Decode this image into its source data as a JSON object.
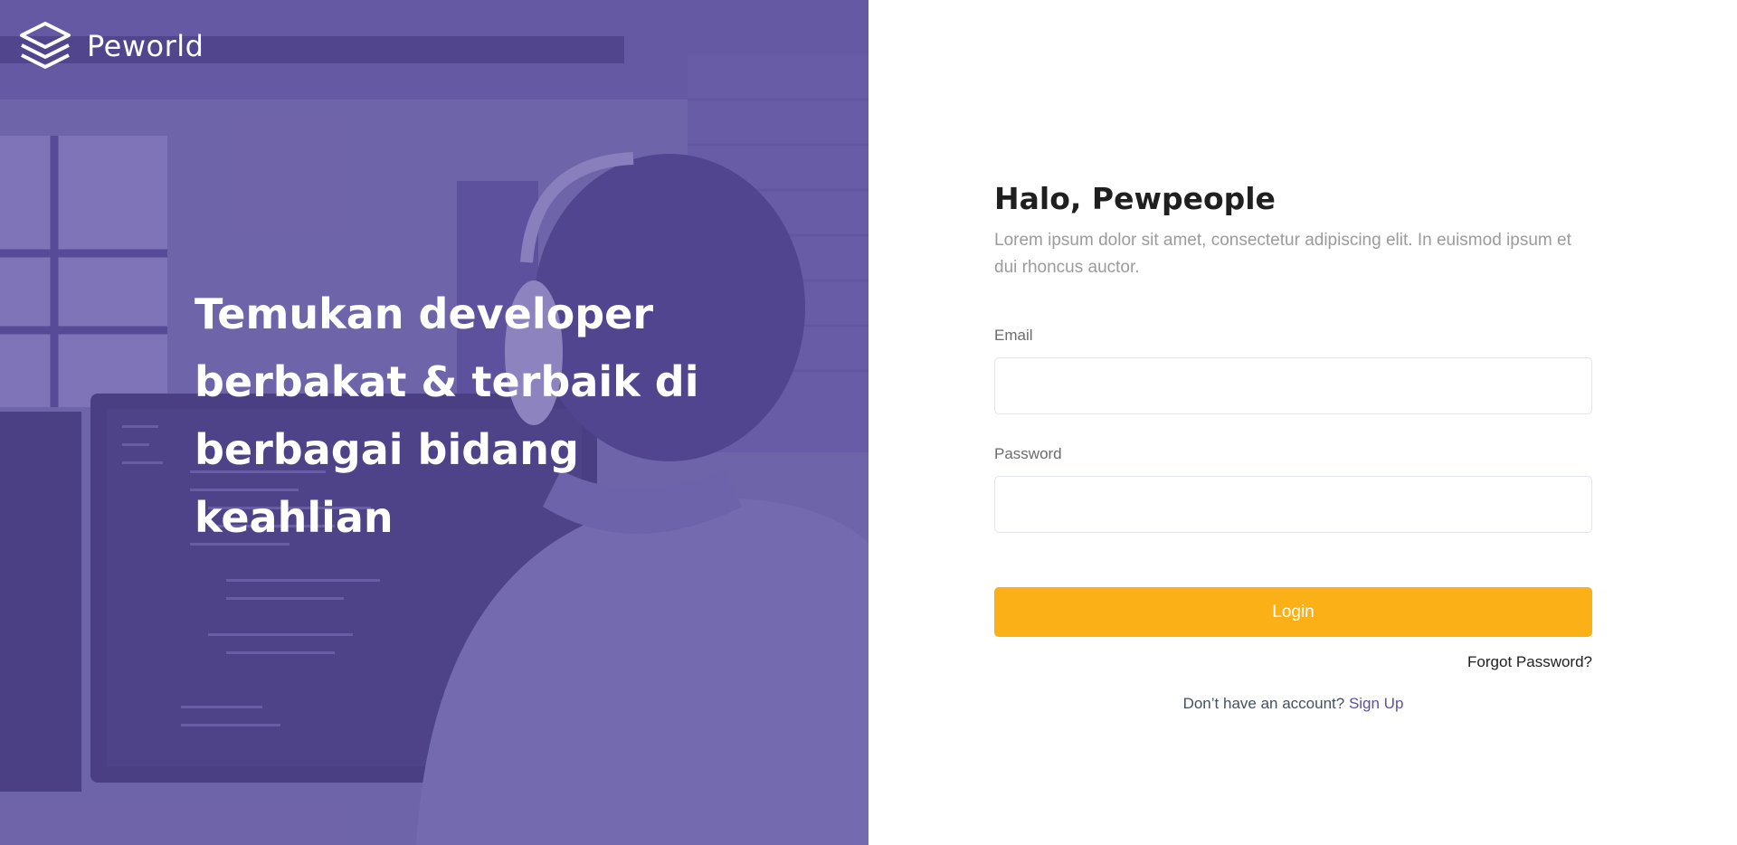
{
  "brand": {
    "name": "Peworld",
    "logo_icon": "layers-icon"
  },
  "hero": {
    "headline": "Temukan developer berbakat & terbaik di berbagai bidang keahlian"
  },
  "login": {
    "greeting": "Halo, Pewpeople",
    "description": "Lorem ipsum dolor sit amet, consectetur adipiscing elit. In euismod ipsum et dui rhoncus auctor.",
    "email_label": "Email",
    "email_value": "",
    "email_placeholder": "",
    "password_label": "Password",
    "password_value": "",
    "password_placeholder": "",
    "login_button": "Login",
    "forgot_password": "Forgot Password?",
    "signup_prompt": "Don’t have an account?",
    "signup_link": "Sign Up"
  },
  "colors": {
    "brand_purple": "#5e50a1",
    "accent_yellow": "#fbb017",
    "muted_text": "#9b9b9b"
  }
}
